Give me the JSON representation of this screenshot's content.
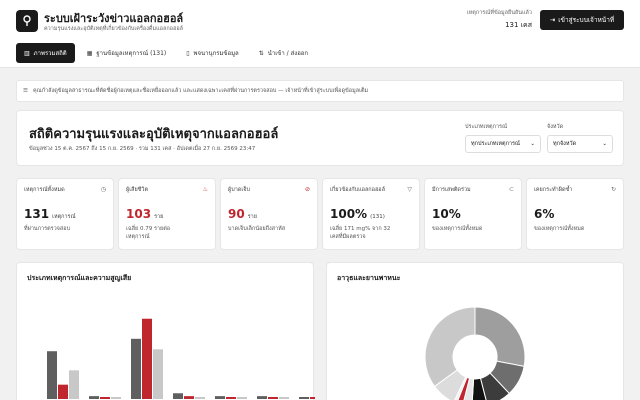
{
  "header": {
    "logo_icon": "map-pin-icon",
    "title": "ระบบเฝ้าระวังข่าวแอลกอฮอล์",
    "subtitle": "ความรุนแรงและอุบัติเหตุที่เกี่ยวข้องกับเครื่องดื่มแอลกอฮอล์",
    "count_label": "เหตุการณ์ที่ข้อมูลยืนยันแล้ว",
    "count_value": "131 เคส",
    "login_icon": "login-icon",
    "login_label": "เข้าสู่ระบบเจ้าหน้าที่"
  },
  "tabs": [
    {
      "icon": "bar-chart-icon",
      "label": "ภาพรวมสถิติ",
      "active": true
    },
    {
      "icon": "table-icon",
      "label": "ฐานข้อมูลเหตุการณ์ (131)",
      "active": false
    },
    {
      "icon": "book-icon",
      "label": "พจนานุกรมข้อมูล",
      "active": false
    },
    {
      "icon": "import-export-icon",
      "label": "นำเข้า / ส่งออก",
      "active": false
    }
  ],
  "notice": {
    "icon": "database-icon",
    "text": "คุณกำลังดูข้อมูลสาธารณะที่ตัดชื่อผู้ก่อเหตุและชื่อเหยื่อออกแล้ว และแสดงเฉพาะเคสที่ผ่านการตรวจสอบ — เจ้าหน้าที่เข้าสู่ระบบเพื่อดูข้อมูลเต็ม"
  },
  "stats": {
    "title": "สถิติความรุนแรงและอุบัติเหตุจากแอลกอฮอล์",
    "meta": "ข้อมูลช่วง 15 ต.ค. 2567 ถึง 15 ก.ย. 2569 · รวม 131 เคส · อัปเดตเมื่อ 27 ก.ย. 2569 23:47",
    "filter_type_label": "ประเภทเหตุการณ์",
    "filter_type_value": "ทุกประเภทเหตุการณ์",
    "filter_province_label": "จังหวัด",
    "filter_province_value": "ทุกจังหวัด"
  },
  "cards": [
    {
      "label": "เหตุการณ์ทั้งหมด",
      "icon": "clock-icon",
      "value": "131",
      "unit": "เหตุการณ์",
      "note": "ที่ผ่านการตรวจสอบ",
      "accent": false
    },
    {
      "label": "ผู้เสียชีวิต",
      "icon": "flame-icon",
      "value": "103",
      "unit": "ราย",
      "note": "เฉลี่ย 0.79 รายต่อ\nเหตุการณ์",
      "accent": true
    },
    {
      "label": "ผู้บาดเจ็บ",
      "icon": "alert-icon",
      "value": "90",
      "unit": "ราย",
      "note": "บาดเจ็บเล็กน้อยถึงสาหัส",
      "accent": true
    },
    {
      "label": "เกี่ยวข้องกับแอลกอฮอล์",
      "icon": "glass-icon",
      "value": "100%",
      "unit": "(131)",
      "note": "เฉลี่ย 171 mg% จาก 32\nเคสที่มีผลตรวจ",
      "accent": false
    },
    {
      "label": "มีการเสพติดร่วม",
      "icon": "link-icon",
      "value": "10%",
      "unit": "",
      "note": "ของเหตุการณ์ทั้งหมด",
      "accent": false
    },
    {
      "label": "เคยกระทำผิดซ้ำ",
      "icon": "repeat-icon",
      "value": "6%",
      "unit": "",
      "note": "ของเหตุการณ์ทั้งหมด",
      "accent": false
    }
  ],
  "panels": {
    "bar_title": "ประเภทเหตุการณ์และความสูญเสีย",
    "donut_title": "อาวุธและยานพาหนะ"
  },
  "colors": {
    "dark": "#1a1a1a",
    "red": "#c0262d",
    "gray": "#5f5f5f",
    "light": "#c8c8c8"
  },
  "chart_data": [
    {
      "type": "bar",
      "title": "ประเภทเหตุการณ์และความสูญเสีย",
      "categories": [
        "",
        "",
        "",
        "",
        "",
        "",
        "",
        "",
        ""
      ],
      "series": [
        {
          "values": [
            50,
            3,
            63,
            6,
            3,
            3,
            2,
            2,
            2
          ]
        },
        {
          "values": [
            15,
            1,
            84,
            3,
            1,
            1,
            1,
            0,
            0
          ]
        },
        {
          "values": [
            30,
            1,
            52,
            2,
            2,
            1,
            1,
            0,
            0
          ]
        }
      ],
      "ylim": [
        0,
        90
      ]
    },
    {
      "type": "pie",
      "title": "อาวุธและยานพาหนะ",
      "values": [
        28,
        10,
        8,
        5,
        3,
        2,
        1,
        8,
        35
      ],
      "colors": [
        "#9e9e9e",
        "#6e6e6e",
        "#3c3c3c",
        "#111111",
        "#e8e8e8",
        "#c0262d",
        "#f2f2f2",
        "#dcdcdc",
        "#c8c8c8"
      ]
    }
  ]
}
